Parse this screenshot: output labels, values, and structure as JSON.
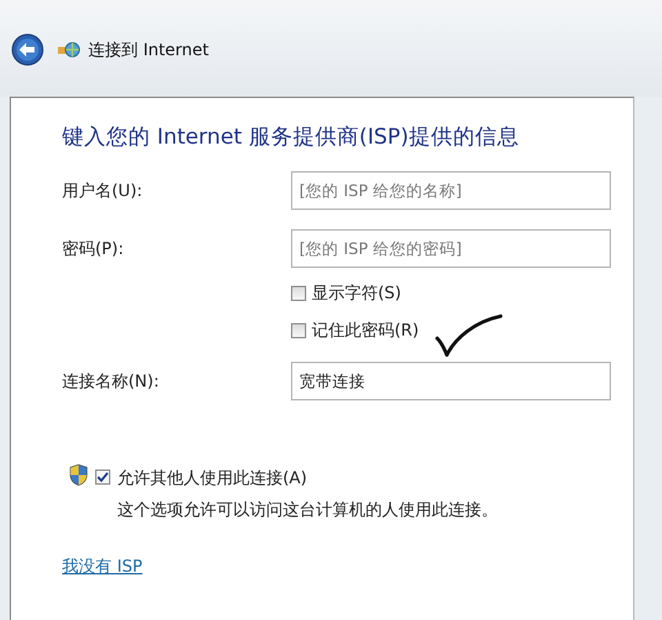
{
  "window": {
    "title": "连接到 Internet"
  },
  "heading": "键入您的 Internet 服务提供商(ISP)提供的信息",
  "fields": [
    {
      "label": "用户名(U):",
      "placeholder": "[您的 ISP 给您的名称]"
    },
    {
      "label": "密码(P):",
      "placeholder": "[您的 ISP 给您的密码]"
    }
  ],
  "options": [
    {
      "label": "显示字符(S)",
      "checked": false
    },
    {
      "label": "记住此密码(R)",
      "checked": false
    }
  ],
  "connection_name": {
    "label": "连接名称(N):",
    "value": "宽带连接"
  },
  "allow_others": {
    "label": "允许其他人使用此连接(A)",
    "checked": true,
    "description": "这个选项允许可以访问这台计算机的人使用此连接。"
  },
  "link": "我没有 ISP"
}
